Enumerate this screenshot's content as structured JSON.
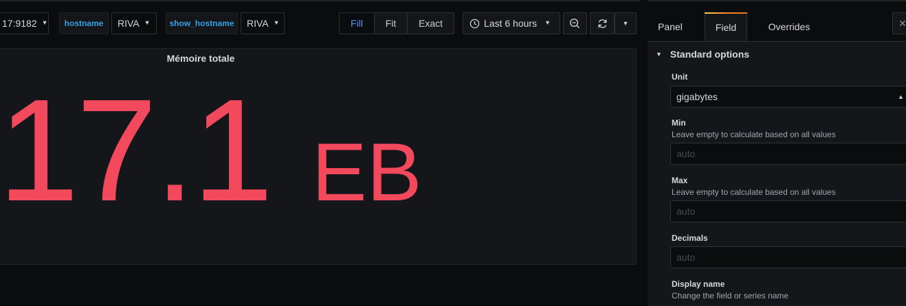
{
  "toolbar": {
    "datasource_value": "17:9182",
    "hostname_label": "hostname",
    "hostname_value": "RIVA",
    "show_hostname_label": "show_hostname",
    "show_hostname_value": "RIVA",
    "view_modes": [
      "Fill",
      "Fit",
      "Exact"
    ],
    "active_view_mode": "Fill",
    "time_range": "Last 6 hours"
  },
  "panel": {
    "title": "Mémoire totale",
    "value": "17.1",
    "unit": "EB",
    "value_color": "#f2495c"
  },
  "editor": {
    "tabs": [
      "Panel",
      "Field",
      "Overrides"
    ],
    "active_tab": "Field",
    "section_title": "Standard options",
    "fields": {
      "unit": {
        "label": "Unit",
        "value": "gigabytes"
      },
      "min": {
        "label": "Min",
        "description": "Leave empty to calculate based on all values",
        "placeholder": "auto"
      },
      "max": {
        "label": "Max",
        "description": "Leave empty to calculate based on all values",
        "placeholder": "auto"
      },
      "decimals": {
        "label": "Decimals",
        "placeholder": "auto"
      },
      "display_name": {
        "label": "Display name",
        "description": "Change the field or series name"
      }
    }
  },
  "colors": {
    "accent_blue": "#5794f2",
    "variable_label": "#33a2e5",
    "stat_red": "#f2495c",
    "background": "#0b0c0e",
    "panel_bg": "#141619"
  },
  "icons": [
    "chevron-down-icon",
    "clock-icon",
    "zoom-out-icon",
    "refresh-icon",
    "chevron-up-icon",
    "close-icon",
    "collapse-caret-icon"
  ]
}
